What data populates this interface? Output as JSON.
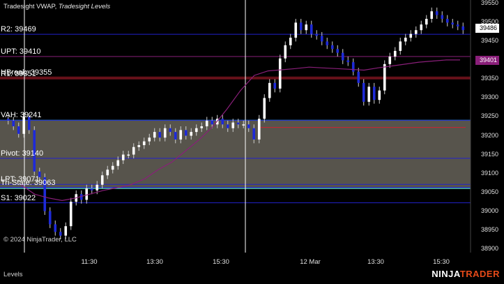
{
  "indicator_title": {
    "name": "Tradesight VWAP,",
    "levels": "Tradesight Levels"
  },
  "copyright": "© 2024 NinjaTrader, LLC",
  "bottom_panel_label": "Levels",
  "brand": {
    "ninja": "NINJA",
    "trader": "TRADER"
  },
  "price_tags": {
    "last": "39486",
    "vwap": "39401"
  },
  "colors": {
    "background": "#000000",
    "up_candle": "#ffffff",
    "down_candle": "#1e2ad8",
    "level_line": "#2222cc",
    "vwap": "#8a1f7a",
    "value_area": "#57544c",
    "va_edge": "#47d0d0",
    "pivot_marker": "#cc2233",
    "brand": "#e64a19"
  },
  "chart_data": {
    "type": "candlestick",
    "y_range": [
      38890,
      39560
    ],
    "y_ticks": [
      "39550",
      "39500",
      "39450",
      "39400",
      "39350",
      "39300",
      "39250",
      "39200",
      "39150",
      "39100",
      "39050",
      "39000",
      "38950",
      "38900"
    ],
    "x_ticks": [
      "11:30",
      "13:30",
      "15:30",
      "12 Mar",
      "13:30",
      "15:30"
    ],
    "levels": [
      {
        "label": "R2: 39469",
        "value": 39469
      },
      {
        "label": "UPT: 39410",
        "value": 39410
      },
      {
        "label": "R1: 39351",
        "value": 39351
      },
      {
        "label": "HBreak: 39355",
        "value": 39355
      },
      {
        "label": "VAH: 39241",
        "value": 39241
      },
      {
        "label": "Pivot: 39140",
        "value": 39140
      },
      {
        "label": "LPT: 39071",
        "value": 39071
      },
      {
        "label": "Tri-State: 39063",
        "value": 39063
      },
      {
        "label": "S1: 39022",
        "value": 39022
      }
    ],
    "value_area": {
      "high": 39241,
      "low": 39060
    },
    "closes": [
      39240,
      39225,
      39205,
      39250,
      39215,
      39105,
      39090,
      39000,
      38965,
      38945,
      38935,
      38960,
      39025,
      39045,
      39030,
      39060,
      39055,
      39070,
      39095,
      39110,
      39120,
      39135,
      39150,
      39150,
      39170,
      39175,
      39185,
      39195,
      39210,
      39195,
      39220,
      39210,
      39190,
      39215,
      39200,
      39210,
      39220,
      39225,
      39240,
      39230,
      39245,
      39230,
      39220,
      39235,
      39230,
      39230,
      39220,
      39190,
      39245,
      39300,
      39340,
      39325,
      39405,
      39440,
      39460,
      39500,
      39480,
      39495,
      39470,
      39465,
      39450,
      39440,
      39430,
      39420,
      39400,
      39395,
      39370,
      39340,
      39290,
      39330,
      39295,
      39320,
      39390,
      39410,
      39425,
      39450,
      39460,
      39470,
      39480,
      39495,
      39510,
      39530,
      39520,
      39510,
      39500,
      39495,
      39490,
      39480
    ],
    "vwap": [
      39070,
      39045,
      39035,
      39028,
      39035,
      39045,
      39055,
      39062,
      39070,
      39085,
      39110,
      39130,
      39160,
      39190,
      39225,
      39270,
      39320,
      39360,
      39372,
      39375,
      39378,
      39382,
      39380,
      39378,
      39376,
      39374,
      39380,
      39385,
      39390,
      39395,
      39398,
      39401,
      39401
    ]
  }
}
